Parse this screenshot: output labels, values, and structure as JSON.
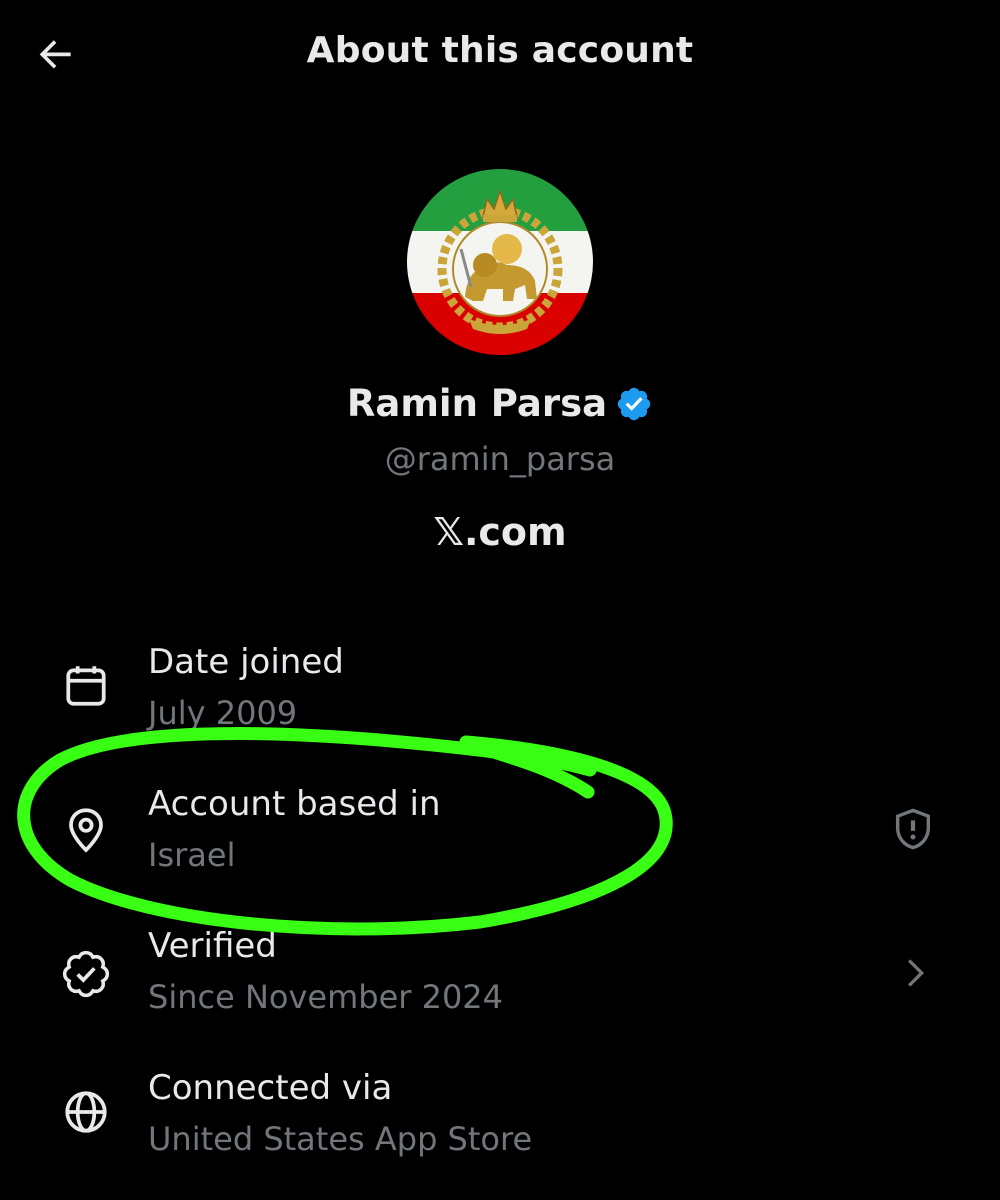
{
  "header": {
    "title": "About this account",
    "back_icon": "arrow-left-icon"
  },
  "profile": {
    "avatar_icon": "flag-lion-and-sun-avatar",
    "display_name": "Ramin Parsa",
    "verified_badge": "verified-badge-icon",
    "handle": "@ramin_parsa",
    "site": "𝕏.com"
  },
  "details": [
    {
      "icon": "calendar-icon",
      "label": "Date joined",
      "value": "July 2009"
    },
    {
      "icon": "location-pin-icon",
      "label": "Account based in",
      "value": "Israel",
      "trailing_icon": "shield-alert-icon"
    },
    {
      "icon": "verified-check-icon",
      "label": "Verified",
      "value": "Since November 2024",
      "trailing_icon": "chevron-right-icon"
    },
    {
      "icon": "globe-icon",
      "label": "Connected via",
      "value": "United States App Store"
    }
  ],
  "colors": {
    "background": "#000000",
    "text_primary": "#e7e9ea",
    "text_secondary": "#71767b",
    "verified_blue": "#1d9bf0",
    "highlight_green": "#39ff14"
  }
}
